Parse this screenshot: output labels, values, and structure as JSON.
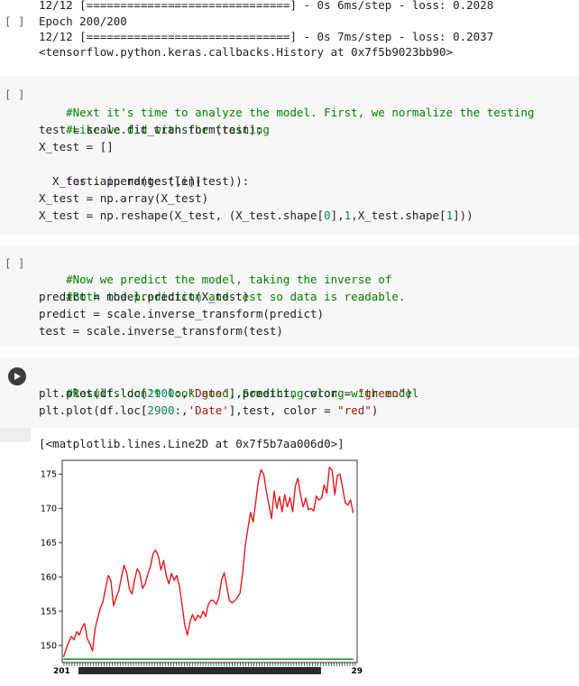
{
  "top_output": {
    "line1": "12/12 [==============================] - 0s 6ms/step - loss: 0.2028",
    "line2_bracket": "[ ]",
    "line2": "Epoch 200/200",
    "line3": "12/12 [==============================] - 0s 7ms/step - loss: 0.2037",
    "line4": "<tensorflow.python.keras.callbacks.History at 0x7f5b9023bb90>"
  },
  "cell1": {
    "bracket": "[ ]",
    "lines": [
      "#Next it's time to analyze the model. First, we normalize the testing",
      "#Like we did with the training",
      "test = scale.fit_transform(test);",
      "X_test = []",
      "for i in range (len(test)):",
      "  X_test.append(test[i])",
      "X_test = np.array(X_test)",
      "X_test = np.reshape(X_test, (X_test.shape[0],1,X_test.shape[1]))"
    ]
  },
  "cell2": {
    "bracket": "[ ]",
    "lines": [
      "#Now we predict the model, taking the inverse of",
      "#Both the prediction and test so data is readable.",
      "predict = model.predict(X_test)",
      "predict = scale.inverse_transform(predict)",
      "test = scale.inverse_transform(test)"
    ]
  },
  "cell3": {
    "run_icon": "play-icon",
    "lines": [
      "#Results don't look good. Something wrong with model",
      "plt.plot(df.loc[2900:,'Date'],predict, color = \"green\")",
      "plt.plot(df.loc[2900:,'Date'],test, color = \"red\")"
    ],
    "output_text": "[<matplotlib.lines.Line2D at 0x7f5b7aa006d0>]"
  },
  "colors": {
    "comment": "#008000",
    "keyword": "#7928a1",
    "number": "#098658",
    "string": "#a31515",
    "series_test": "#e31a1c",
    "series_predict": "#008000",
    "cell_bg": "#f7f7f7"
  },
  "chart_data": {
    "type": "line",
    "title": "",
    "xlabel": "",
    "ylabel": "",
    "ylim": [
      147.5,
      177
    ],
    "yticks": [
      150,
      155,
      160,
      165,
      170,
      175
    ],
    "x_tick_labels_note": "x tick labels are overlapping dates rendered as an unreadable dense band",
    "x_tick_labels_start": "201",
    "x_tick_labels_end": "29",
    "grid": false,
    "series": [
      {
        "color": "green",
        "values": [
          148,
          148,
          148,
          148,
          148,
          148,
          148,
          148,
          148,
          148,
          148,
          148,
          148,
          148,
          148,
          148,
          148,
          148,
          148,
          148,
          148,
          148,
          148,
          148,
          148,
          148,
          148,
          148,
          148,
          148,
          148,
          148,
          148,
          148,
          148,
          148,
          148,
          148,
          148,
          148,
          148,
          148,
          148,
          148,
          148,
          148,
          148,
          148,
          148,
          148,
          148,
          148,
          148,
          148,
          148,
          148,
          148,
          148,
          148,
          148,
          148,
          148,
          148,
          148,
          148,
          148,
          148,
          148,
          148,
          148,
          148,
          148,
          148,
          148,
          148,
          148,
          148,
          148,
          148,
          148,
          148,
          148,
          148,
          148,
          148,
          148,
          148,
          148,
          148,
          148,
          148,
          148,
          148,
          148,
          148,
          148,
          148,
          148,
          148,
          148,
          148,
          148,
          148,
          148,
          148,
          148,
          148,
          148,
          148,
          148,
          148,
          148,
          148,
          148,
          148,
          148,
          148,
          148,
          148,
          148
        ]
      },
      {
        "color": "red",
        "values": [
          148.3,
          149.5,
          150.5,
          151.3,
          150.8,
          152.0,
          151.5,
          152.6,
          153.2,
          151.0,
          150.2,
          149.2,
          152.5,
          154.0,
          155.5,
          156.4,
          158.5,
          160.2,
          159.4,
          155.8,
          157.0,
          158.0,
          160.0,
          161.7,
          160.6,
          158.2,
          157.5,
          159.6,
          161.2,
          160.5,
          158.3,
          159.0,
          160.4,
          161.5,
          163.4,
          163.9,
          163.0,
          161.0,
          162.4,
          160.2,
          159.0,
          160.5,
          159.5,
          160.2,
          158.7,
          156.0,
          153.0,
          151.5,
          153.4,
          154.5,
          153.6,
          154.4,
          154.0,
          155.0,
          154.2,
          156.0,
          156.6,
          156.5,
          156.0,
          157.0,
          159.5,
          160.6,
          158.6,
          156.5,
          156.2,
          156.5,
          157.0,
          157.6,
          160.5,
          164.5,
          167.0,
          169.4,
          168.0,
          171.0,
          174.0,
          175.6,
          175.0,
          172.5,
          170.5,
          168.5,
          172.5,
          170.0,
          171.7,
          169.5,
          172.0,
          170.2,
          171.6,
          169.5,
          173.2,
          174.4,
          172.0,
          170.2,
          171.5,
          169.8,
          170.0,
          169.6,
          171.8,
          171.2,
          171.5,
          173.4,
          172.2,
          176.0,
          175.5,
          172.0,
          174.8,
          175.0,
          173.0,
          170.8,
          170.5,
          171.2,
          169.3
        ]
      }
    ]
  }
}
